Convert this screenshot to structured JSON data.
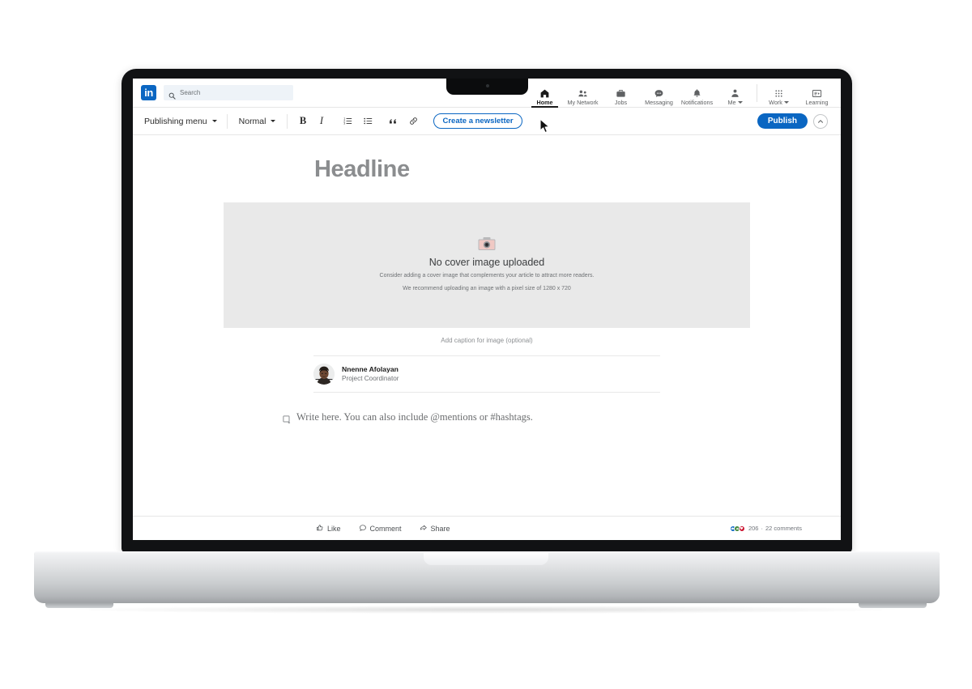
{
  "global_nav": {
    "logo_text": "in",
    "search": {
      "placeholder": "Search",
      "icon": "search-icon"
    },
    "items": [
      {
        "label": "Home",
        "icon": "home-icon",
        "active": true
      },
      {
        "label": "My Network",
        "icon": "network-icon",
        "active": false
      },
      {
        "label": "Jobs",
        "icon": "briefcase-icon",
        "active": false
      },
      {
        "label": "Messaging",
        "icon": "message-bubble-icon",
        "active": false
      },
      {
        "label": "Notifications",
        "icon": "bell-icon",
        "active": false
      },
      {
        "label": "Me",
        "icon": "avatar-icon",
        "active": false,
        "caret": true
      },
      {
        "label": "Work",
        "icon": "grid-apps-icon",
        "active": false,
        "caret": true
      },
      {
        "label": "Learning",
        "icon": "learning-icon",
        "active": false
      }
    ]
  },
  "toolbar": {
    "publishing_menu_label": "Publishing menu",
    "style_label": "Normal",
    "bold_label": "B",
    "italic_label": "I",
    "bulleted_list_icon": "bulleted-list-icon",
    "numbered_list_icon": "numbered-list-icon",
    "quote_icon": "blockquote-icon",
    "link_icon": "link-icon",
    "create_newsletter_label": "Create a newsletter",
    "publish_label": "Publish",
    "collapse_icon": "chevron-up-icon"
  },
  "article": {
    "headline_placeholder": "Headline",
    "cover": {
      "icon": "camera-icon",
      "title": "No cover image uploaded",
      "hint_line1": "Consider adding a cover image that complements your article to attract more readers.",
      "hint_line2": "We recommend uploading an image with a pixel size of 1280 x 720"
    },
    "caption_placeholder": "Add caption for image (optional)",
    "author": {
      "name": "Nnenne Afolayan",
      "title": "Project Coordinator"
    },
    "body_placeholder": "Write here. You can also include @mentions or #hashtags."
  },
  "social_bar": {
    "actions": [
      {
        "label": "Like",
        "icon": "thumbs-up-icon"
      },
      {
        "label": "Comment",
        "icon": "comment-icon"
      },
      {
        "label": "Share",
        "icon": "share-icon"
      }
    ],
    "reaction_count": "206",
    "separator": "·",
    "comment_count": "22 comments"
  },
  "colors": {
    "brand_blue": "#0a66c2",
    "placeholder_gray": "#e9e9e9",
    "text_dark": "#1b1b1b",
    "text_muted": "#6e7174"
  }
}
